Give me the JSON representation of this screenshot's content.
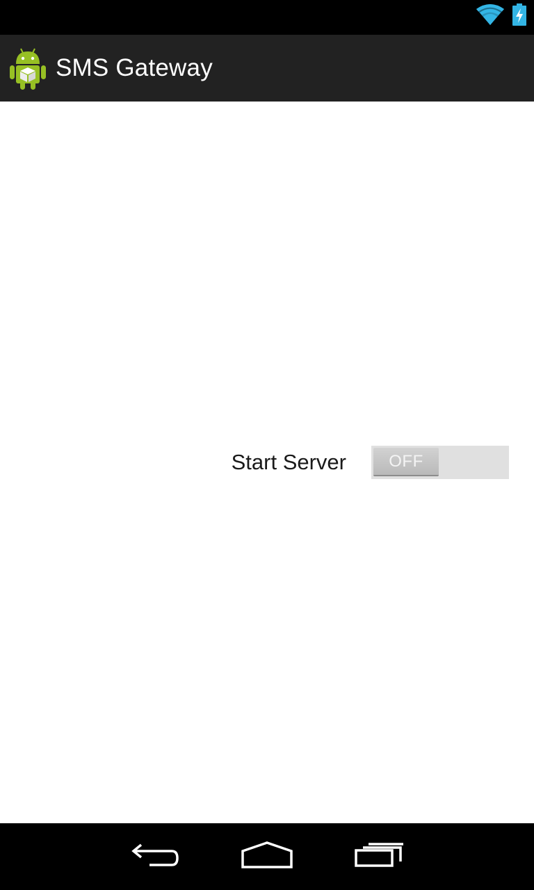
{
  "status_bar": {
    "icons": [
      "wifi-icon",
      "battery-charging-icon"
    ],
    "accent_color": "#33b5e5"
  },
  "action_bar": {
    "app_icon": "android-app-icon",
    "title": "SMS Gateway",
    "background": "#222222"
  },
  "content": {
    "switch_label": "Start Server",
    "switch": {
      "state_text": "OFF",
      "checked": false
    }
  },
  "nav_bar": {
    "buttons": [
      "back-icon",
      "home-icon",
      "recents-icon"
    ]
  }
}
